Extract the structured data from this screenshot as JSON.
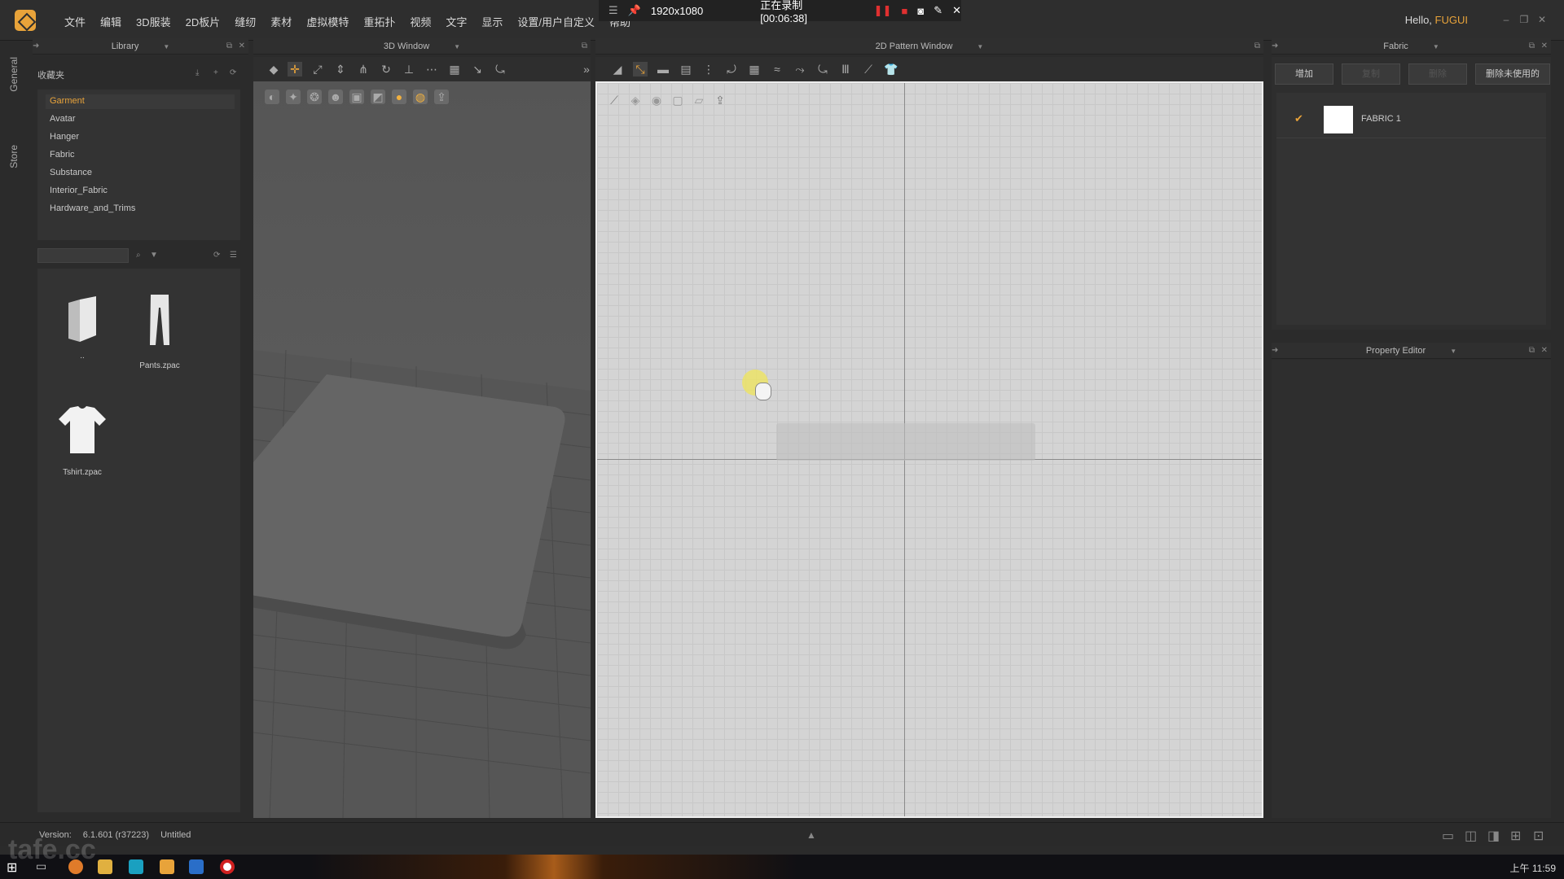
{
  "menubar": {
    "items": [
      "文件",
      "编辑",
      "3D服装",
      "2D板片",
      "缝纫",
      "素材",
      "虚拟模特",
      "重拓扑",
      "视频",
      "文字",
      "显示",
      "设置/用户自定义",
      "帮助"
    ],
    "hello_prefix": "Hello, ",
    "username": "FUGUI"
  },
  "recording": {
    "resolution": "1920x1080",
    "status": "正在录制 [00:06:38]"
  },
  "left_tabs": [
    "General",
    "Store"
  ],
  "library": {
    "header": "Library",
    "favorites_label": "收藏夹",
    "tree": [
      "Garment",
      "Avatar",
      "Hanger",
      "Fabric",
      "Substance",
      "Interior_Fabric",
      "Hardware_and_Trims"
    ],
    "active_index": 0,
    "search_placeholder": "",
    "items": [
      {
        "label": "..",
        "icon": "folder-icon"
      },
      {
        "label": "Pants.zpac",
        "icon": "pants-icon"
      },
      {
        "label": "Tshirt.zpac",
        "icon": "tshirt-icon"
      }
    ]
  },
  "window3d": {
    "header": "3D Window"
  },
  "window2d": {
    "header": "2D Pattern Window"
  },
  "fabric": {
    "header": "Fabric",
    "buttons": [
      "增加",
      "复制",
      "删除",
      "删除未使用的"
    ],
    "list": [
      {
        "name": "FABRIC 1",
        "swatch_color": "#ffffff",
        "checked": true
      }
    ]
  },
  "property_editor": {
    "header": "Property Editor"
  },
  "status": {
    "version_label": "Version:",
    "version": "6.1.601 (r37223)",
    "file": "Untitled"
  },
  "taskbar": {
    "clock": "上午 11:59"
  },
  "watermark": "tafe.cc",
  "colors": {
    "accent": "#e8a33a",
    "panel": "#2e2e2e",
    "canvas2d": "#d4d4d4"
  }
}
